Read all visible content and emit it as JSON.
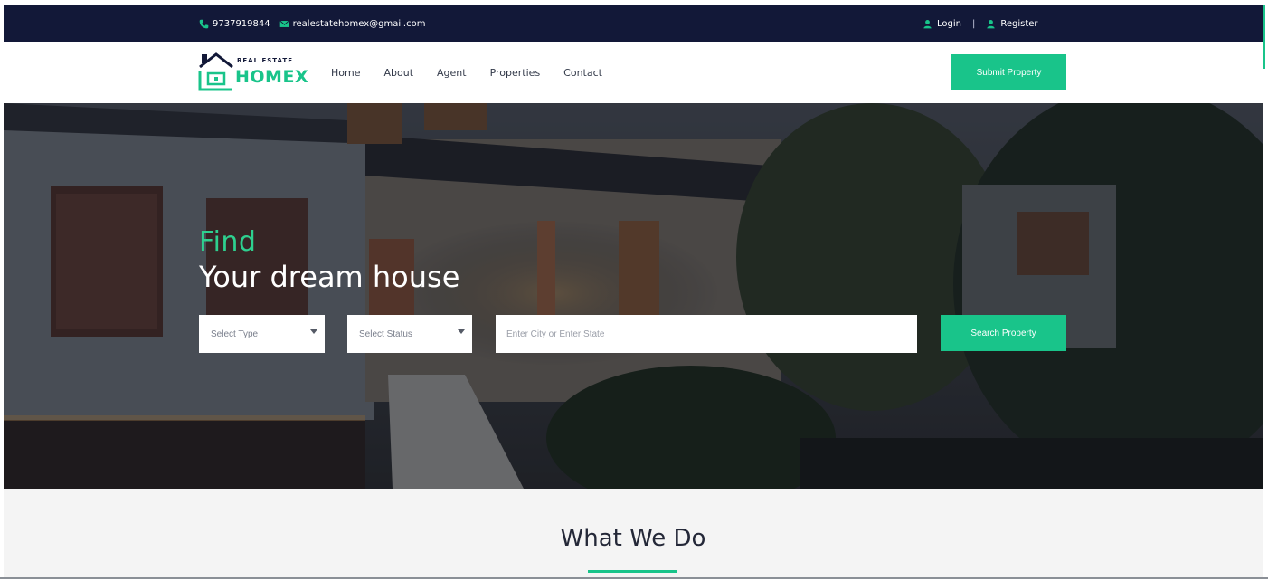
{
  "topbar": {
    "phone": "9737919844",
    "email": "realestatehomex@gmail.com",
    "login_label": "Login",
    "separator": "|",
    "register_label": "Register"
  },
  "logo": {
    "small_text": "REAL ESTATE",
    "big_text": "HOMEX"
  },
  "nav": {
    "items": [
      {
        "label": "Home"
      },
      {
        "label": "About"
      },
      {
        "label": "Agent"
      },
      {
        "label": "Properties"
      },
      {
        "label": "Contact"
      }
    ],
    "submit_label": "Submit Property"
  },
  "hero": {
    "headline_1": "Find",
    "headline_2": "Your dream house",
    "select_type": "Select Type",
    "select_status": "Select Status",
    "city_placeholder": "Enter City or Enter State",
    "search_label": "Search Property"
  },
  "section": {
    "title": "What We Do"
  },
  "colors": {
    "accent": "#19c48a",
    "topbar_bg": "#121838",
    "section_bg": "#f4f4f4"
  },
  "icons": {
    "phone": "phone-icon",
    "email": "mail-icon",
    "login": "user-icon",
    "register": "user-icon",
    "logo": "house-icon",
    "select_caret": "chevron-down-icon"
  }
}
